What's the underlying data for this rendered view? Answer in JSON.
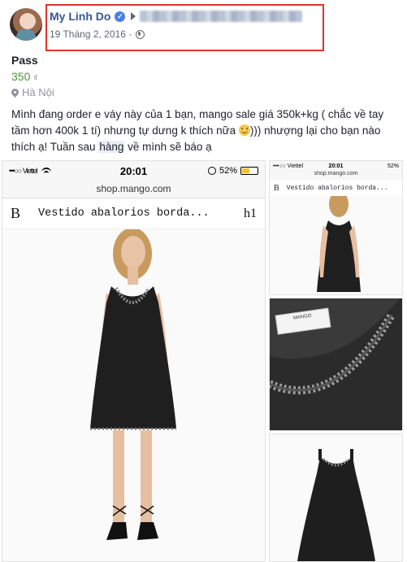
{
  "post": {
    "author": "My Linh Do",
    "date": "19 Tháng 2, 2016 ·"
  },
  "listing": {
    "title": "Pass",
    "price": "350",
    "currency": "₫",
    "location": "Hà Nội",
    "text_before_emoji": "Mình đang order e váy này của 1 bạn, mango sale giá 350k+kg ( chắc về tay tầm hơn 400k 1 tí) nhưng tự dưng k thích nữa ",
    "text_after_emoji": "))) nhượng lại cho bạn nào thích ạ! Tuần sau ",
    "highlighted_word": "hàng",
    "text_end": " về mình sẽ báo ạ"
  },
  "phone_screenshot": {
    "carrier": "•••○○ Viettel",
    "time": "20:01",
    "battery": "52%",
    "battery_level": 0.52,
    "url": "shop.mango.com",
    "brand_letter": "B",
    "product_name": "Vestido abalorios borda...",
    "bag_icon": "h1"
  },
  "thumbnails": {
    "carrier": "•••○○ Viettel",
    "time": "20:01",
    "battery": "52%",
    "url": "shop.mango.com",
    "brand_letter": "B",
    "product_name": "Vestido abalorios borda...",
    "label_brand": "MANGO"
  },
  "colors": {
    "author_link": "#365899",
    "price_green": "#4b9a3f",
    "highlight_border": "#e0332b",
    "dress": "#1f1f1f"
  }
}
